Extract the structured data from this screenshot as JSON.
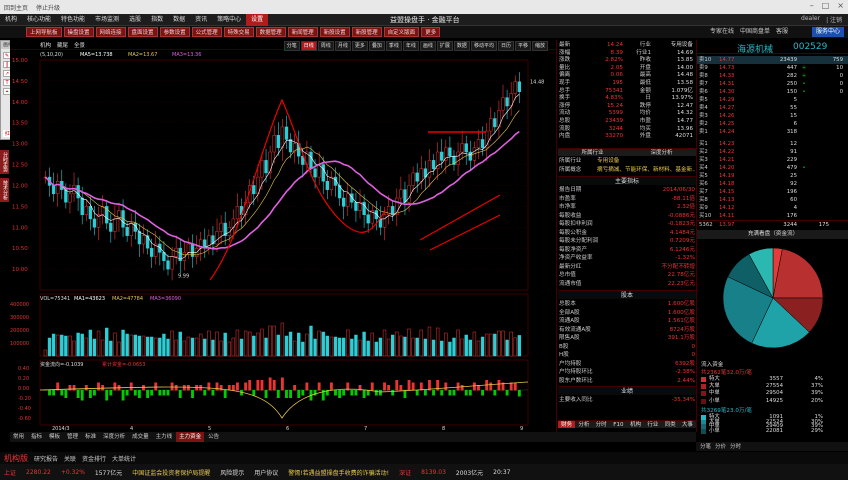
{
  "titlebar": {
    "left1": "回到主页",
    "left2": "停止升级",
    "center": "益盟操盘手 · 金融平台"
  },
  "menu": [
    "机构",
    "核心功能",
    "特色功能",
    "市场监测",
    "选股",
    "指数",
    "数据",
    "资讯",
    "策略中心",
    "设置"
  ],
  "menu_active_index": 9,
  "menu_center": "益盟操盘手 · 金融平台",
  "menu_right": [
    "dealer",
    "| 注销"
  ],
  "toolbar": [
    "上网导航板",
    "操盘设置",
    "网络连接",
    "盘面设置",
    "参数设置",
    "公式管理",
    "特殊交易",
    "数据管理",
    "新闻管理",
    "新股设置",
    "新股管理",
    "自定义版面",
    "更多"
  ],
  "toolbar_right": [
    "专家在线",
    "中国商盘单",
    "客服"
  ],
  "toolbar_button": "服务中心",
  "drawpal": {
    "title": "画线工具",
    "footer": "红线射线"
  },
  "sidetabs": [
    "分时走势",
    "技术分析"
  ],
  "chart_header": {
    "labels": [
      "机构",
      "藏尾",
      "全景"
    ],
    "ma": "MA5=13.738",
    "ma10": "MA2=13.67",
    "ma20": "MA3=13.36",
    "date": "(5,10,20)"
  },
  "period_tabs": [
    "分笔",
    "日线",
    "周线",
    "月线",
    "更多",
    "叠加",
    "季线",
    "年线",
    "画线",
    "扩展",
    "数据",
    "移动平均",
    "日历",
    "平移",
    "缩放"
  ],
  "period_selected": 1,
  "chart_data": {
    "type": "candlestick",
    "price_ylim": [
      9.5,
      15
    ],
    "price_ticks": [
      "15.00",
      "14.50",
      "14.00",
      "13.50",
      "13.00",
      "12.50",
      "12.00",
      "11.50",
      "11.00",
      "10.50",
      "10.00"
    ],
    "high_label": "14.48",
    "low_label": "9.99",
    "x_ticks": [
      "2014/3",
      "4",
      "5",
      "6",
      "7",
      "8",
      "9"
    ],
    "close": [
      12.2,
      12.0,
      11.8,
      12.1,
      11.9,
      11.6,
      11.8,
      12.0,
      11.7,
      11.3,
      11.5,
      11.2,
      11.0,
      11.3,
      11.5,
      11.1,
      10.9,
      11.2,
      11.4,
      11.0,
      10.8,
      11.1,
      10.9,
      10.6,
      10.8,
      10.5,
      10.3,
      10.6,
      10.4,
      10.2,
      10.0,
      10.3,
      10.5,
      10.2,
      10.4,
      10.6,
      10.3,
      10.5,
      10.7,
      10.5,
      10.8,
      10.6,
      10.9,
      11.1,
      10.8,
      11.0,
      11.2,
      11.5,
      11.3,
      11.6,
      12.0,
      11.8,
      12.2,
      12.6,
      12.3,
      12.8,
      13.2,
      12.9,
      13.4,
      13.1,
      12.8,
      13.0,
      12.7,
      12.5,
      12.8,
      12.4,
      12.2,
      12.5,
      12.1,
      11.9,
      12.2,
      12.0,
      11.7,
      11.5,
      11.8,
      11.6,
      11.4,
      11.6,
      11.3,
      11.1,
      11.4,
      11.2,
      11.0,
      11.3,
      11.5,
      11.3,
      11.7,
      11.9,
      11.6,
      12.0,
      12.3,
      12.1,
      12.4,
      12.2,
      12.6,
      12.4,
      12.8,
      12.6,
      12.9,
      12.7,
      12.5,
      12.8,
      13.0,
      12.8,
      12.6,
      12.9,
      13.1,
      12.9,
      13.3,
      13.6,
      13.4,
      13.8,
      14.1,
      13.9,
      14.2,
      14.48,
      14.24
    ],
    "volume_label": "VOL=75341",
    "vol_ma1": "MA1=43623",
    "vol_ma2": "MA2=47784",
    "vol_ma3": "MA3=36090",
    "vol_ticks": [
      "400000",
      "300000",
      "200000",
      "100000"
    ],
    "macd_label": "资金流向=-0.1039",
    "macd_a": "累计资金=-0.0653",
    "macd_ticks": [
      "0.40",
      "0.20",
      "0.00",
      "-0.20",
      "-0.40",
      "-0.60"
    ]
  },
  "quote": {
    "rows": [
      [
        "最新",
        "14.24",
        "行业",
        "专用设备"
      ],
      [
        "涨幅",
        "8.39",
        "行业1",
        "14.69"
      ],
      [
        "涨跌",
        "2.82%",
        "昨收",
        "13.85"
      ],
      [
        "量比",
        "2.05",
        "开盘",
        "14.00"
      ],
      [
        "偏离",
        "0.06",
        "最高",
        "14.48"
      ],
      [
        "现手",
        "195",
        "最低",
        "13.58"
      ],
      [
        "总手",
        "75341",
        "金额",
        "1.079亿"
      ],
      [
        "换手",
        "4.83%",
        "日",
        "13.97%"
      ],
      [
        "涨停",
        "15.24",
        "跌停",
        "12.47"
      ],
      [
        "流动",
        "5399",
        "均价",
        "14.32"
      ],
      [
        "总股",
        "23439",
        "市盈",
        "14.77"
      ],
      [
        "流股",
        "3244",
        "均买",
        "13.96"
      ],
      [
        "内盘",
        "33270",
        "外盘",
        "42071"
      ]
    ]
  },
  "industry_tabs": [
    "所属行业",
    "深度分析"
  ],
  "industry": {
    "k1": "所属行业",
    "v1": "专用设备",
    "k2": "所属概念",
    "v2": "摘亏摘减、节能环保、新材料、基金新…"
  },
  "fund_title": "主要指标",
  "fund_rows": [
    [
      "报告日期",
      "2014/06/30"
    ],
    [
      "市盈率",
      "-88.11倍"
    ],
    [
      "市净率",
      "2.32倍"
    ],
    [
      "每股收益",
      "-0.0886元"
    ],
    [
      "每股扣非利润",
      "-0.1823元"
    ],
    [
      "每股公积金",
      "4.1484元"
    ],
    [
      "每股未分配利润",
      "0.7209元"
    ],
    [
      "每股净资产",
      "6.1246元"
    ],
    [
      "净资产收益率",
      "-1.32%"
    ],
    [
      "最新分红",
      "不分配不转增"
    ],
    [
      "总市值",
      "22.78亿元"
    ],
    [
      "流通市值",
      "22.23亿元"
    ]
  ],
  "share_title": "股本",
  "share_rows": [
    [
      "总股本",
      "1.600亿股"
    ],
    [
      "全部A股",
      "1.600亿股"
    ],
    [
      "流通A股",
      "1.561亿股"
    ],
    [
      "有效流通A股",
      "8724万股"
    ],
    [
      "限售A股",
      "391.1万股"
    ],
    [
      "B股",
      "0"
    ],
    [
      "H股",
      "0"
    ],
    [
      "户均持股",
      "6392股"
    ],
    [
      "户均持股环比",
      "-2.38%"
    ],
    [
      "股东户数环比",
      "2.44%"
    ]
  ],
  "trade_title": "业绩",
  "trade_row": [
    "主要收入同比",
    "-35.34%"
  ],
  "right_tabs": [
    "财务",
    "分析",
    "分时",
    "F10",
    "机构",
    "行业",
    "同类",
    "大事"
  ],
  "orderbook": {
    "name": "海源机械",
    "code": "002529",
    "rows": [
      [
        "卖10",
        "14.77",
        "23439",
        "",
        "759"
      ],
      [
        "卖9",
        "14.73",
        "447",
        "+",
        "10"
      ],
      [
        "卖8",
        "14.33",
        "282",
        "+",
        "0"
      ],
      [
        "卖7",
        "14.31",
        "250",
        "•",
        "0"
      ],
      [
        "卖6",
        "14.30",
        "150",
        "•",
        "0"
      ],
      [
        "卖5",
        "14.29",
        "5",
        "",
        ""
      ],
      [
        "卖4",
        "14.27",
        "55",
        "",
        ""
      ],
      [
        "卖3",
        "14.26",
        "15",
        "",
        ""
      ],
      [
        "卖2",
        "14.25",
        "6",
        "",
        ""
      ],
      [
        "卖1",
        "14.24",
        "318",
        "",
        ""
      ],
      [
        "买1",
        "14.23",
        "12",
        "",
        ""
      ],
      [
        "买2",
        "14.22",
        "91",
        "",
        ""
      ],
      [
        "买3",
        "14.21",
        "229",
        "",
        ""
      ],
      [
        "买4",
        "14.20",
        "479",
        "•",
        ""
      ],
      [
        "买5",
        "14.19",
        "25",
        "",
        ""
      ],
      [
        "买6",
        "14.18",
        "92",
        "",
        ""
      ],
      [
        "买7",
        "14.15",
        "196",
        "",
        ""
      ],
      [
        "买8",
        "14.13",
        "60",
        "",
        ""
      ],
      [
        "买9",
        "14.12",
        "4",
        "",
        ""
      ],
      [
        "买10",
        "14.11",
        "176",
        "",
        ""
      ]
    ],
    "summary": [
      "5362",
      "13.97",
      "3244",
      "175"
    ]
  },
  "pie": {
    "title": "充满看盘（资金流）",
    "colors": [
      "#e43b3b",
      "#b83030",
      "#8a2020",
      "#1fa3a8",
      "#178089",
      "#0f5f66",
      "#2ab8b0"
    ],
    "values": [
      3,
      22,
      12,
      20,
      25,
      10,
      8
    ]
  },
  "flow": {
    "in_title": "流入资金",
    "in_subtitle": "共2362笔32.0万/笔",
    "in": [
      [
        "特大",
        "3557",
        "4%",
        "#c33"
      ],
      [
        "大单",
        "27554",
        "37%",
        "#a22"
      ],
      [
        "中单",
        "29504",
        "39%",
        "#811"
      ],
      [
        "小单",
        "14925",
        "20%",
        "#611"
      ]
    ],
    "out_subtitle": "共3269笔23.0万/笔",
    "out": [
      [
        "特大",
        "1091",
        "1%",
        "#29b8c7"
      ],
      [
        "大单",
        "22524",
        "30%",
        "#1b8a94"
      ],
      [
        "中单",
        "29409",
        "39%",
        "#176a72"
      ],
      [
        "小单",
        "22081",
        "29%",
        "#0f4e54"
      ]
    ]
  },
  "bottom_tabs": [
    "常用",
    "指标",
    "模板",
    "管理",
    "标准",
    "深度分析",
    "成交量",
    "主力线",
    "主力资金",
    "公告"
  ],
  "bottom_sel": 8,
  "right_bottom_tabs": [
    "分笔",
    "分价",
    "分时"
  ],
  "status": [
    "机构版",
    "研究报告",
    "关联",
    "资金排行",
    "大单统计"
  ],
  "ticker": {
    "idx1": "上证",
    "v1": "2280.22",
    "c1": "+0.32%",
    "amt1": "1577亿元",
    "idx2": "深证",
    "v2": "8139.03",
    "c2": "+1.02%",
    "amt2": "2003亿元",
    "idx3": "创业",
    "v3": "1413.65",
    "c3": "+0.24%",
    "amt3": "7550亿元",
    "news": "中国证监会投资者保护局提醒",
    "news2": "风险提示",
    "news3": "用户协议",
    "news4": "警惕!若遇益盟操盘手收费的诈骗活动!",
    "news5": "规范交易机构信息",
    "time": "09:24",
    "time2": "20:37",
    "extra": "连接正常"
  }
}
